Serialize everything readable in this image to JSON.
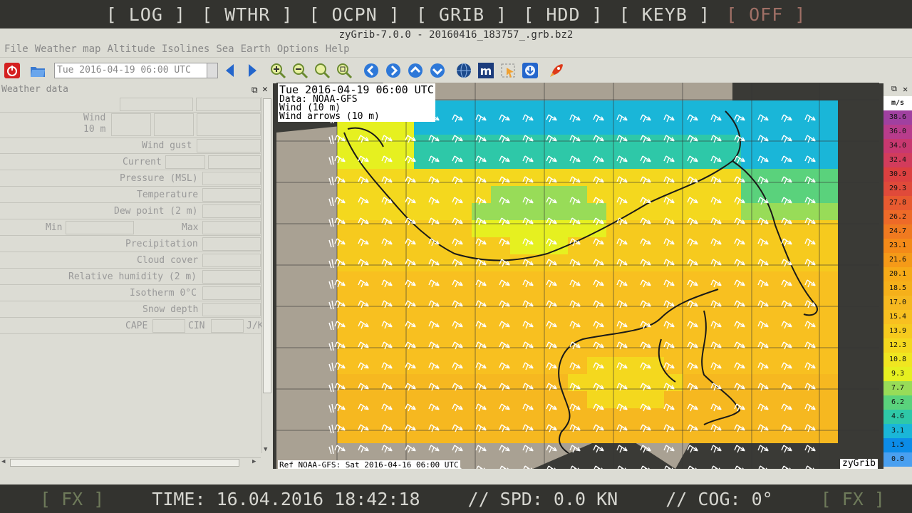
{
  "topbar": {
    "buttons": [
      "[ LOG ]",
      "[ WTHR ]",
      "[ OCPN ]",
      "[ GRIB ]",
      "[ HDD ]",
      "[ KEYB ]",
      "[ OFF ]"
    ]
  },
  "window": {
    "title": "zyGrib-7.0.0 - 20160416_183757_.grb.bz2"
  },
  "menu": [
    "File",
    "Weather map",
    "Altitude",
    "Isolines",
    "Sea",
    "Earth",
    "Options",
    "Help"
  ],
  "toolbar": {
    "date": "Tue 2016-04-19 06:00 UTC"
  },
  "panel": {
    "title": "Weather data",
    "wind": "Wind",
    "wind_sub": "10 m",
    "wind_gust": "Wind gust",
    "current": "Current",
    "pressure": "Pressure (MSL)",
    "temperature": "Temperature",
    "dew_point": "Dew point (2 m)",
    "min": "Min",
    "max": "Max",
    "precipitation": "Precipitation",
    "cloud_cover": "Cloud cover",
    "humidity": "Relative humidity (2 m)",
    "isotherm": "Isotherm 0°C",
    "snow": "Snow depth",
    "cape": "CAPE",
    "cin": "CIN",
    "jkg": "J/K"
  },
  "map": {
    "time": "Tue 2016-04-19 06:00 UTC",
    "data": "Data: NOAA-GFS",
    "wind": "Wind (10 m)",
    "arrows": "Wind arrows (10 m)",
    "ref": "Ref NOAA-GFS: Sat 2016-04-16 06:00 UTC",
    "brand": "zyGrib"
  },
  "legend": {
    "unit": "m/s",
    "values": [
      "38.6",
      "36.0",
      "34.0",
      "32.4",
      "30.9",
      "29.3",
      "27.8",
      "26.2",
      "24.7",
      "23.1",
      "21.6",
      "20.1",
      "18.5",
      "17.0",
      "15.4",
      "13.9",
      "12.3",
      "10.8",
      "9.3",
      "7.7",
      "6.2",
      "4.6",
      "3.1",
      "1.5",
      "0.0"
    ],
    "colors": [
      "#a040a0",
      "#b83c8c",
      "#c83870",
      "#d23c5c",
      "#dc4040",
      "#e04a3a",
      "#e85a30",
      "#ee6a28",
      "#f07a20",
      "#f48a18",
      "#f59a18",
      "#f6aa18",
      "#f5b01a",
      "#f6b820",
      "#f8c020",
      "#f6ca1e",
      "#f4d81e",
      "#f0e620",
      "#e6f020",
      "#98dc58",
      "#5ad27c",
      "#2ec8a8",
      "#1ab6d8",
      "#0c8ce8",
      "#4aa0f0"
    ]
  },
  "status": {
    "fx_left": "[ FX ]",
    "time": "TIME: 16.04.2016 18:42:18",
    "spd": "// SPD: 0.0 KN",
    "cog": "// COG: 0°",
    "fx_right": "[ FX ]"
  }
}
